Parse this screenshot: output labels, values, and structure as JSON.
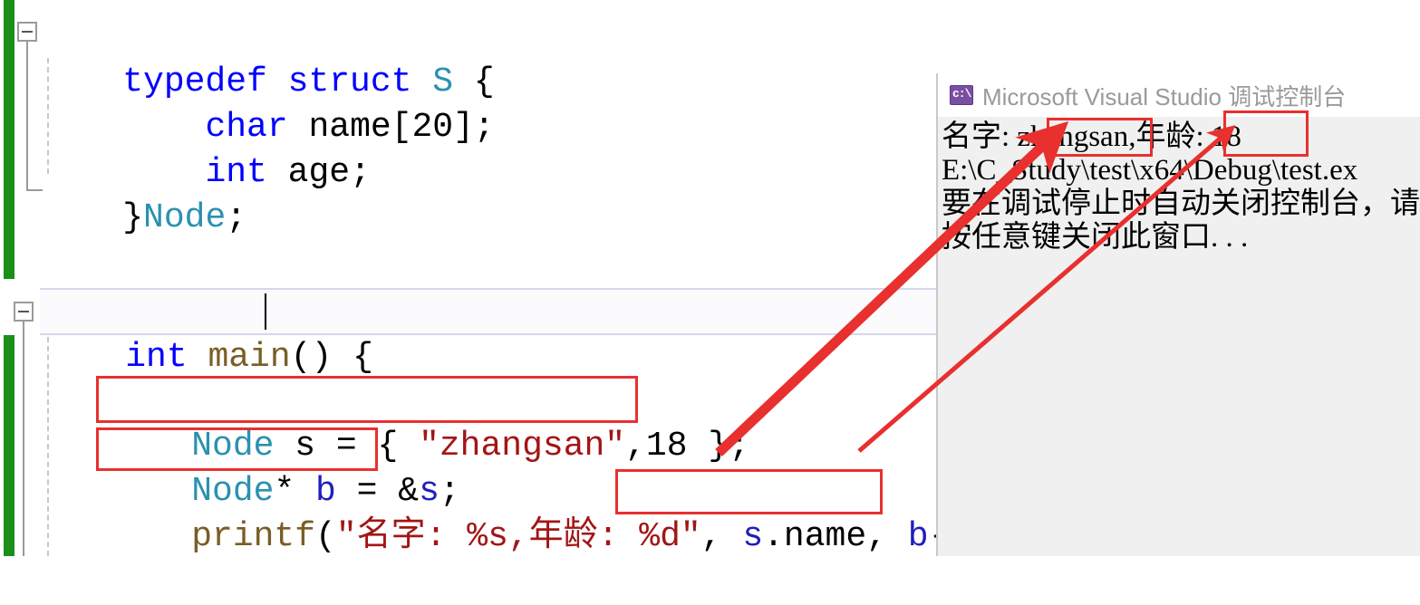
{
  "editor": {
    "name": "visual-studio-code-editor",
    "lines": [
      {
        "id": "line-typedef",
        "text": "typedef struct S {",
        "segments": [
          {
            "t": "typedef struct ",
            "c": "kw"
          },
          {
            "t": "S",
            "c": "type"
          },
          {
            "t": " {",
            "c": "plain"
          }
        ]
      },
      {
        "id": "line-char-name",
        "text": "    char name[20];",
        "segments": [
          {
            "t": "    ",
            "c": "plain"
          },
          {
            "t": "char",
            "c": "kw"
          },
          {
            "t": " name[20];",
            "c": "plain"
          }
        ]
      },
      {
        "id": "line-int-age",
        "text": "    int age;",
        "segments": [
          {
            "t": "    ",
            "c": "plain"
          },
          {
            "t": "int",
            "c": "kw"
          },
          {
            "t": " age;",
            "c": "plain"
          }
        ]
      },
      {
        "id": "line-close-node",
        "text": "}Node;",
        "segments": [
          {
            "t": "}",
            "c": "plain"
          },
          {
            "t": "Node",
            "c": "type"
          },
          {
            "t": ";",
            "c": "plain"
          }
        ]
      },
      {
        "id": "line-main",
        "text": "int main() {",
        "segments": [
          {
            "t": "int",
            "c": "kw"
          },
          {
            "t": " ",
            "c": "plain"
          },
          {
            "t": "main",
            "c": "fn"
          },
          {
            "t": "() {",
            "c": "plain"
          }
        ]
      },
      {
        "id": "line-node-s",
        "text": "Node s = { \"zhangsan\",18 };",
        "segments": [
          {
            "t": "Node",
            "c": "type"
          },
          {
            "t": " s = { ",
            "c": "plain"
          },
          {
            "t": "\"zhangsan\"",
            "c": "str"
          },
          {
            "t": ",18 };",
            "c": "plain"
          }
        ]
      },
      {
        "id": "line-node-b",
        "text": "Node* b = &s;",
        "segments": [
          {
            "t": "Node",
            "c": "type"
          },
          {
            "t": "* ",
            "c": "plain"
          },
          {
            "t": "b",
            "c": "var"
          },
          {
            "t": " = &",
            "c": "plain"
          },
          {
            "t": "s",
            "c": "var"
          },
          {
            "t": ";",
            "c": "plain"
          }
        ]
      },
      {
        "id": "line-printf",
        "text": "printf(\"名字: %s,年龄: %d\", s.name, b->age);",
        "segments": [
          {
            "t": "printf",
            "c": "fn"
          },
          {
            "t": "(",
            "c": "plain"
          },
          {
            "t": "\"名字: %s,年龄: %d\"",
            "c": "str"
          },
          {
            "t": ", ",
            "c": "plain"
          },
          {
            "t": "s",
            "c": "var"
          },
          {
            "t": ".name, ",
            "c": "plain"
          },
          {
            "t": "b",
            "c": "var"
          },
          {
            "t": "->age);",
            "c": "plain"
          }
        ]
      }
    ],
    "caret_line": "int main() {",
    "annotations": [
      {
        "id": "anno-node-s",
        "label": "red-box-node-s-declaration"
      },
      {
        "id": "anno-node-b",
        "label": "red-box-node-pointer-declaration"
      },
      {
        "id": "anno-printf-args",
        "label": "red-box-printf-arguments"
      },
      {
        "id": "anno-zhangsan",
        "label": "red-box-console-name-output"
      },
      {
        "id": "anno-age",
        "label": "red-box-console-age-output"
      }
    ]
  },
  "console": {
    "icon_name": "command-prompt-icon",
    "icon_text": "c:\\",
    "title": "Microsoft Visual Studio 调试控制台",
    "output": [
      "名字: zhangsan,年龄: 18",
      "E:\\C_Study\\test\\x64\\Debug\\test.ex",
      "要在调试停止时自动关闭控制台，请启",
      "按任意键关闭此窗口. . ."
    ],
    "output_parts": {
      "line1_prefix": "名字: ",
      "line1_name": "zhangsan,",
      "line1_mid": "年龄: ",
      "line1_age": "18",
      "line2": "E:\\C_Study\\test\\x64\\Debug\\test.ex",
      "line3": "要在调试停止时自动关闭控制台，请启",
      "line4": "按任意键关闭此窗口. . ."
    }
  },
  "colors": {
    "keyword": "#0000ff",
    "type": "#2b91af",
    "function": "#795e26",
    "string": "#a31515",
    "annotation_red": "#e8302f",
    "change_bar_green": "#1a8f1a",
    "console_bg": "#f0f0f0",
    "console_icon_purple": "#7a4fa3"
  }
}
